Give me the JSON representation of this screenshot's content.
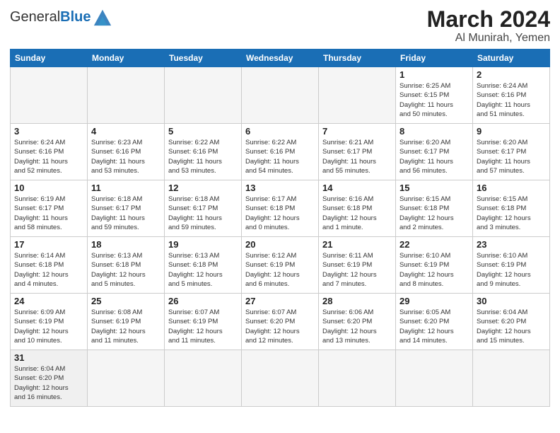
{
  "header": {
    "logo_general": "General",
    "logo_blue": "Blue",
    "title": "March 2024",
    "subtitle": "Al Munirah, Yemen"
  },
  "days_of_week": [
    "Sunday",
    "Monday",
    "Tuesday",
    "Wednesday",
    "Thursday",
    "Friday",
    "Saturday"
  ],
  "weeks": [
    [
      {
        "day": "",
        "info": ""
      },
      {
        "day": "",
        "info": ""
      },
      {
        "day": "",
        "info": ""
      },
      {
        "day": "",
        "info": ""
      },
      {
        "day": "",
        "info": ""
      },
      {
        "day": "1",
        "info": "Sunrise: 6:25 AM\nSunset: 6:15 PM\nDaylight: 11 hours\nand 50 minutes."
      },
      {
        "day": "2",
        "info": "Sunrise: 6:24 AM\nSunset: 6:16 PM\nDaylight: 11 hours\nand 51 minutes."
      }
    ],
    [
      {
        "day": "3",
        "info": "Sunrise: 6:24 AM\nSunset: 6:16 PM\nDaylight: 11 hours\nand 52 minutes."
      },
      {
        "day": "4",
        "info": "Sunrise: 6:23 AM\nSunset: 6:16 PM\nDaylight: 11 hours\nand 53 minutes."
      },
      {
        "day": "5",
        "info": "Sunrise: 6:22 AM\nSunset: 6:16 PM\nDaylight: 11 hours\nand 53 minutes."
      },
      {
        "day": "6",
        "info": "Sunrise: 6:22 AM\nSunset: 6:16 PM\nDaylight: 11 hours\nand 54 minutes."
      },
      {
        "day": "7",
        "info": "Sunrise: 6:21 AM\nSunset: 6:17 PM\nDaylight: 11 hours\nand 55 minutes."
      },
      {
        "day": "8",
        "info": "Sunrise: 6:20 AM\nSunset: 6:17 PM\nDaylight: 11 hours\nand 56 minutes."
      },
      {
        "day": "9",
        "info": "Sunrise: 6:20 AM\nSunset: 6:17 PM\nDaylight: 11 hours\nand 57 minutes."
      }
    ],
    [
      {
        "day": "10",
        "info": "Sunrise: 6:19 AM\nSunset: 6:17 PM\nDaylight: 11 hours\nand 58 minutes."
      },
      {
        "day": "11",
        "info": "Sunrise: 6:18 AM\nSunset: 6:17 PM\nDaylight: 11 hours\nand 59 minutes."
      },
      {
        "day": "12",
        "info": "Sunrise: 6:18 AM\nSunset: 6:17 PM\nDaylight: 11 hours\nand 59 minutes."
      },
      {
        "day": "13",
        "info": "Sunrise: 6:17 AM\nSunset: 6:18 PM\nDaylight: 12 hours\nand 0 minutes."
      },
      {
        "day": "14",
        "info": "Sunrise: 6:16 AM\nSunset: 6:18 PM\nDaylight: 12 hours\nand 1 minute."
      },
      {
        "day": "15",
        "info": "Sunrise: 6:15 AM\nSunset: 6:18 PM\nDaylight: 12 hours\nand 2 minutes."
      },
      {
        "day": "16",
        "info": "Sunrise: 6:15 AM\nSunset: 6:18 PM\nDaylight: 12 hours\nand 3 minutes."
      }
    ],
    [
      {
        "day": "17",
        "info": "Sunrise: 6:14 AM\nSunset: 6:18 PM\nDaylight: 12 hours\nand 4 minutes."
      },
      {
        "day": "18",
        "info": "Sunrise: 6:13 AM\nSunset: 6:18 PM\nDaylight: 12 hours\nand 5 minutes."
      },
      {
        "day": "19",
        "info": "Sunrise: 6:13 AM\nSunset: 6:18 PM\nDaylight: 12 hours\nand 5 minutes."
      },
      {
        "day": "20",
        "info": "Sunrise: 6:12 AM\nSunset: 6:19 PM\nDaylight: 12 hours\nand 6 minutes."
      },
      {
        "day": "21",
        "info": "Sunrise: 6:11 AM\nSunset: 6:19 PM\nDaylight: 12 hours\nand 7 minutes."
      },
      {
        "day": "22",
        "info": "Sunrise: 6:10 AM\nSunset: 6:19 PM\nDaylight: 12 hours\nand 8 minutes."
      },
      {
        "day": "23",
        "info": "Sunrise: 6:10 AM\nSunset: 6:19 PM\nDaylight: 12 hours\nand 9 minutes."
      }
    ],
    [
      {
        "day": "24",
        "info": "Sunrise: 6:09 AM\nSunset: 6:19 PM\nDaylight: 12 hours\nand 10 minutes."
      },
      {
        "day": "25",
        "info": "Sunrise: 6:08 AM\nSunset: 6:19 PM\nDaylight: 12 hours\nand 11 minutes."
      },
      {
        "day": "26",
        "info": "Sunrise: 6:07 AM\nSunset: 6:19 PM\nDaylight: 12 hours\nand 11 minutes."
      },
      {
        "day": "27",
        "info": "Sunrise: 6:07 AM\nSunset: 6:20 PM\nDaylight: 12 hours\nand 12 minutes."
      },
      {
        "day": "28",
        "info": "Sunrise: 6:06 AM\nSunset: 6:20 PM\nDaylight: 12 hours\nand 13 minutes."
      },
      {
        "day": "29",
        "info": "Sunrise: 6:05 AM\nSunset: 6:20 PM\nDaylight: 12 hours\nand 14 minutes."
      },
      {
        "day": "30",
        "info": "Sunrise: 6:04 AM\nSunset: 6:20 PM\nDaylight: 12 hours\nand 15 minutes."
      }
    ],
    [
      {
        "day": "31",
        "info": "Sunrise: 6:04 AM\nSunset: 6:20 PM\nDaylight: 12 hours\nand 16 minutes."
      },
      {
        "day": "",
        "info": ""
      },
      {
        "day": "",
        "info": ""
      },
      {
        "day": "",
        "info": ""
      },
      {
        "day": "",
        "info": ""
      },
      {
        "day": "",
        "info": ""
      },
      {
        "day": "",
        "info": ""
      }
    ]
  ]
}
